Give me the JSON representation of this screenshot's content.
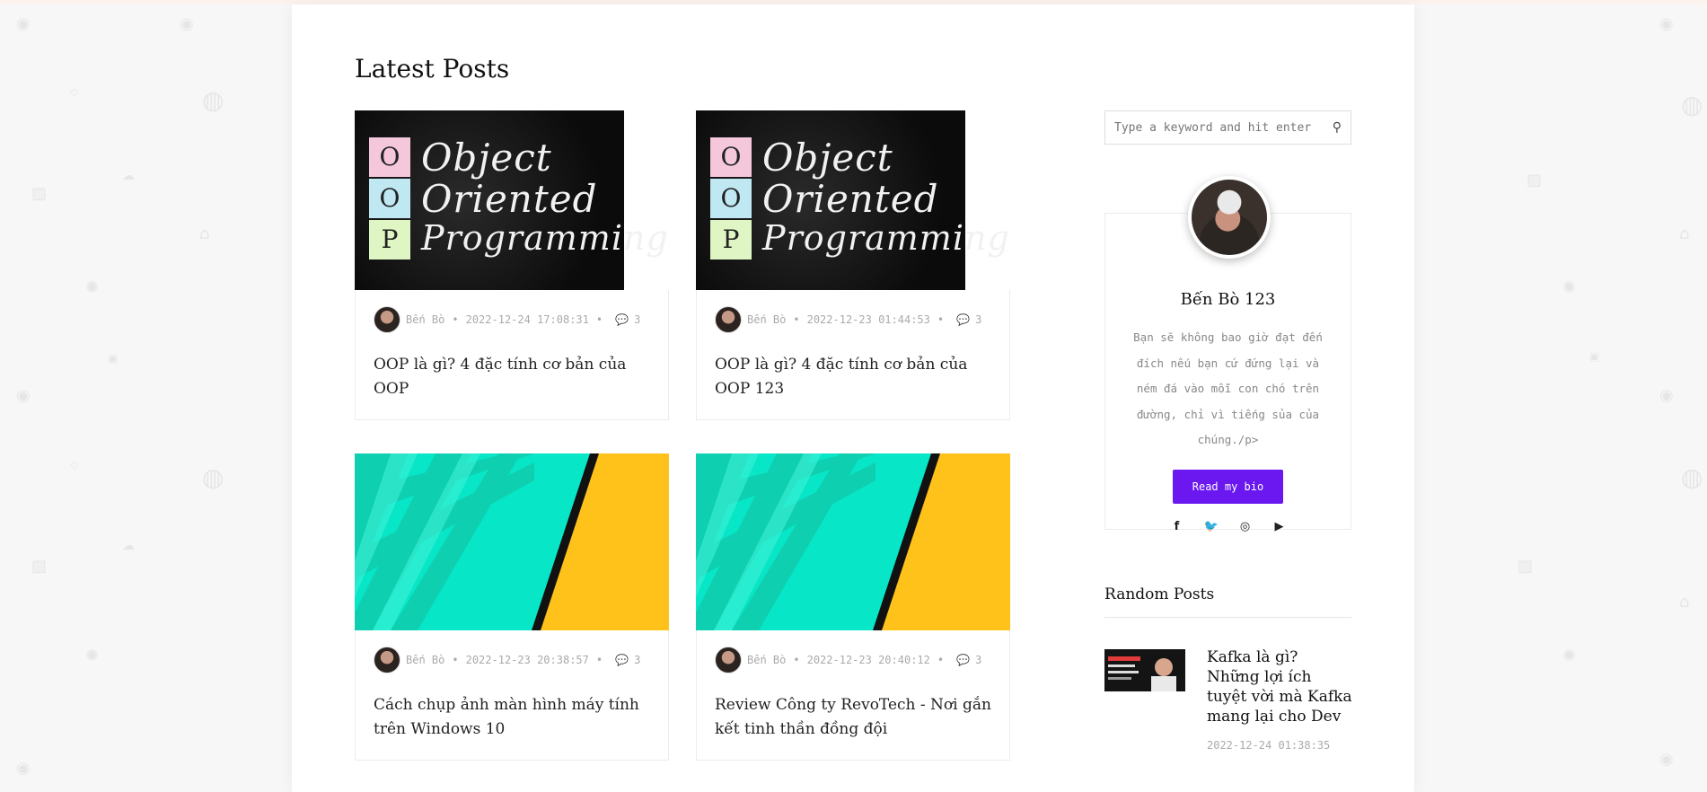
{
  "section_title": "Latest Posts",
  "posts": [
    {
      "author": "Bến Bò",
      "date": "2022-12-24 17:08:31",
      "comments": "3",
      "title": "OOP là gì? 4 đặc tính cơ bản của OOP",
      "thumb": "oop"
    },
    {
      "author": "Bến Bò",
      "date": "2022-12-23 01:44:53",
      "comments": "3",
      "title": "OOP là gì? 4 đặc tính cơ bản của OOP 123",
      "thumb": "oop"
    },
    {
      "author": "Bến Bò",
      "date": "2022-12-23 20:38:57",
      "comments": "3",
      "title": "Cách chụp ảnh màn hình máy tính trên Windows 10",
      "thumb": "comic"
    },
    {
      "author": "Bến Bò",
      "date": "2022-12-23 20:40:12",
      "comments": "3",
      "title": "Review Công ty RevoTech - Nơi gắn kết tinh thần đồng đội",
      "thumb": "comic"
    }
  ],
  "oop_thumb": {
    "letters": [
      "O",
      "O",
      "P"
    ],
    "words": [
      "Object",
      "Oriented",
      "Programming"
    ]
  },
  "search": {
    "placeholder": "Type a keyword and hit enter"
  },
  "bio": {
    "name": "Bến Bò 123",
    "text": "Bạn sẽ không bao giờ đạt đến đích nếu bạn cứ đứng lại và ném đá vào mỗi con chó trên đường, chỉ vì tiếng sủa của chúng./p>",
    "button": "Read my bio",
    "socials": [
      "facebook-icon",
      "twitter-icon",
      "instagram-icon",
      "youtube-icon"
    ]
  },
  "random": {
    "title": "Random Posts",
    "items": [
      {
        "title": "Kafka là gì? Những lợi ích tuyệt vời mà Kafka mang lại cho Dev",
        "date": "2022-12-24 01:38:35"
      }
    ]
  },
  "colors": {
    "accent": "#6a17f0",
    "comic_teal": "#07e6c6",
    "comic_yellow": "#ffc21a"
  }
}
